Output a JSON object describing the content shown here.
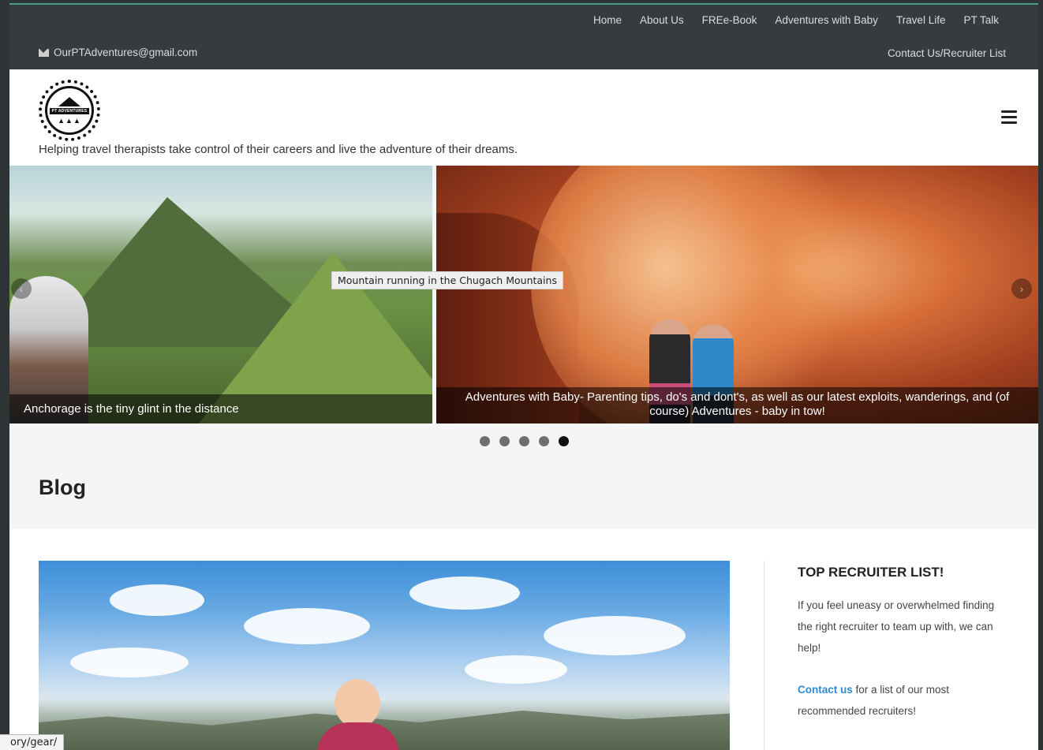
{
  "topbar": {
    "nav": [
      "Home",
      "About Us",
      "FREe-Book",
      "Adventures with Baby",
      "Travel Life",
      "PT Talk"
    ],
    "email": "OurPTAdventures@gmail.com",
    "contact_link": "Contact Us/Recruiter List"
  },
  "header": {
    "logo_text": "PT ADVENTURES",
    "tagline": "Helping travel therapists take control of their careers and live the adventure of their dreams."
  },
  "slider": {
    "left_caption": "Anchorage is the tiny glint in the distance",
    "right_caption": "Adventures with Baby- Parenting tips, do's and dont's, as well as our latest exploits, wanderings, and (of course) Adventures - baby in tow!",
    "tooltip": "Mountain running in the Chugach Mountains",
    "dot_count": 5,
    "active_dot": 5
  },
  "blog": {
    "title": "Blog"
  },
  "sidebar": {
    "heading": "TOP RECRUITER LIST!",
    "para1": "If you feel uneasy or overwhelmed finding the right recruiter to team up with, we can help!",
    "link_text": "Contact us",
    "para2_rest": " for a list of our most recommended recruiters!"
  },
  "status_bar": {
    "url": "ory/gear/"
  },
  "colors": {
    "topbar_bg": "#363b3e",
    "link_blue": "#2b8ad6",
    "band_bg": "#f5f5f6"
  }
}
